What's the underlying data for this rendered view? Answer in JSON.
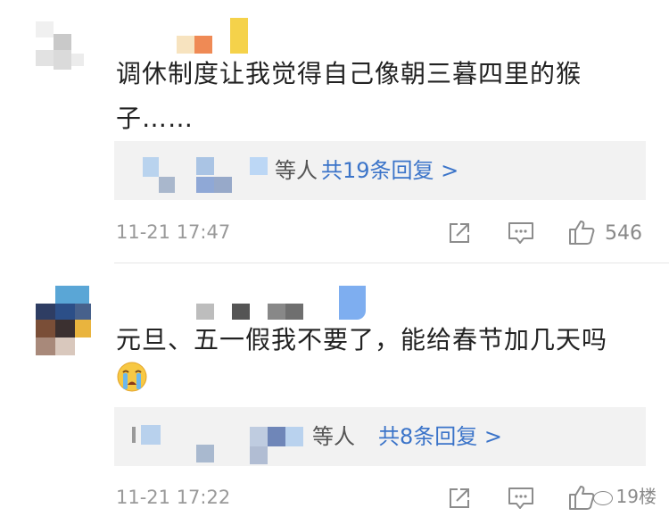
{
  "comments": [
    {
      "text": "调休制度让我觉得自己像朝三暮四里的猴子……",
      "replies_suffix": "等人",
      "replies_link": "共19条回复 >",
      "time": "11-21 17:47",
      "like_count": "546"
    },
    {
      "text": "元旦、五一假我不要了，能给春节加几天吗",
      "replies_suffix": "等人",
      "replies_link": "共8条回复 >",
      "time": "11-21 17:22"
    }
  ],
  "icons": {
    "share": "share-icon",
    "comment": "comment-icon",
    "like": "thumbs-up-icon",
    "emoji": "crying-emoji"
  },
  "watermark": "19楼"
}
